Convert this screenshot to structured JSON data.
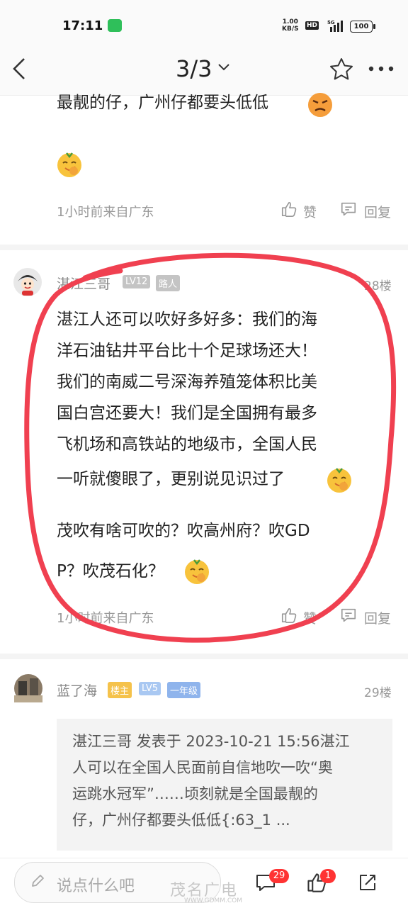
{
  "status_bar": {
    "time": "17:11",
    "net_speed_value": "1.00",
    "net_speed_unit": "KB/S",
    "hd": "HD",
    "network": "5G",
    "battery": "100"
  },
  "nav": {
    "page_indicator": "3/3"
  },
  "comments": [
    {
      "text_lines": [
        "最靓的仔，广州仔都要头低低"
      ],
      "meta": "1小时前来自广东",
      "like_label": "赞",
      "reply_label": "回复"
    },
    {
      "username": "湛江三哥",
      "badges": [
        "LV12",
        "路人"
      ],
      "floor": "28楼",
      "text_lines": [
        "湛江人还可以吹好多好多：我们的海",
        "洋石油钻井平台比十个足球场还大！",
        "我们的南威二号深海养殖笼体积比美",
        "国白宫还要大！我们是全国拥有最多",
        "飞机场和高铁站的地级市，全国人民",
        "一听就傻眼了，更别说见识过了",
        "茂吹有啥可吹的？吹高州府？吹GD",
        "P？吹茂石化？"
      ],
      "meta": "1小时前来自广东",
      "like_label": "赞",
      "reply_label": "回复"
    },
    {
      "username": "蓝了海",
      "badges": [
        "楼主",
        "LV5",
        "一年级"
      ],
      "floor": "29楼",
      "quote_lines": [
        "湛江三哥 发表于 2023-10-21 15:56湛江",
        "人可以在全国人民面前自信地吹一吹“奥",
        "运跳水冠军”……顷刻就是全国最靓的",
        "仔，广州仔都要头低低{:63_1 ..."
      ]
    }
  ],
  "bottom_bar": {
    "input_placeholder": "说点什么吧",
    "comment_count": "29",
    "like_count": "1"
  },
  "watermark": {
    "text": "茂名广电",
    "url": "WWW.GDMM.COM"
  },
  "colors": {
    "annotation_red": "#f04050",
    "badge_gray": "#c4c4c4",
    "badge_host": "#f5c24b",
    "badge_level": "#a9c8f2",
    "badge_grade": "#8fb4ec",
    "notification_red": "#ff3333"
  },
  "icons": [
    "back-arrow-icon",
    "chevron-down-icon",
    "star-icon",
    "more-icon",
    "thumbs-up-icon",
    "reply-icon",
    "pen-icon",
    "comment-icon",
    "share-icon",
    "emoji-face-icon",
    "angry-face-icon"
  ]
}
